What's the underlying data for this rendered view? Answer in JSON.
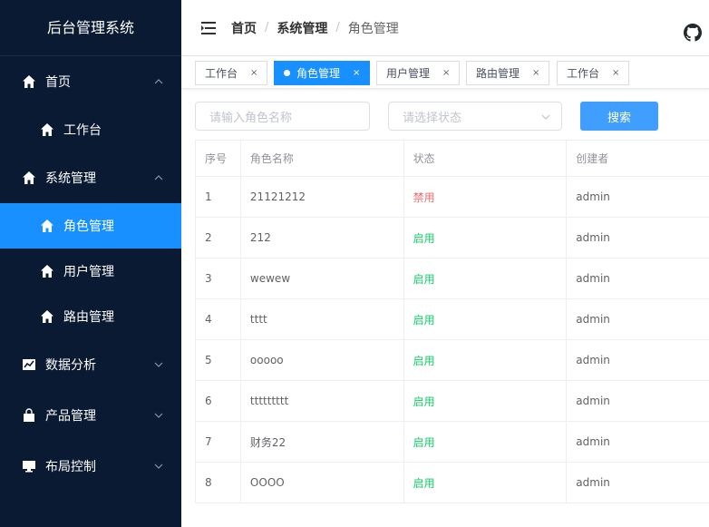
{
  "app_title": "后台管理系统",
  "sidebar": {
    "items": [
      {
        "label": "首页",
        "type": "group",
        "expanded": true,
        "icon": "home-icon"
      },
      {
        "label": "工作台",
        "type": "sub",
        "icon": "home-icon"
      },
      {
        "label": "系统管理",
        "type": "group",
        "expanded": true,
        "icon": "home-icon"
      },
      {
        "label": "角色管理",
        "type": "sub",
        "active": true,
        "icon": "home-icon"
      },
      {
        "label": "用户管理",
        "type": "sub",
        "icon": "home-icon"
      },
      {
        "label": "路由管理",
        "type": "sub",
        "icon": "home-icon"
      },
      {
        "label": "数据分析",
        "type": "group",
        "expanded": false,
        "icon": "chart-icon"
      },
      {
        "label": "产品管理",
        "type": "group",
        "expanded": false,
        "icon": "bag-icon"
      },
      {
        "label": "布局控制",
        "type": "group",
        "expanded": false,
        "icon": "monitor-icon"
      }
    ]
  },
  "breadcrumb": [
    "首页",
    "系统管理",
    "角色管理"
  ],
  "tags": [
    {
      "label": "工作台",
      "active": false
    },
    {
      "label": "角色管理",
      "active": true
    },
    {
      "label": "用户管理",
      "active": false
    },
    {
      "label": "路由管理",
      "active": false
    },
    {
      "label": "工作台",
      "active": false
    }
  ],
  "tag_close": "×",
  "filters": {
    "name_placeholder": "请输入角色名称",
    "status_placeholder": "请选择状态",
    "search_label": "搜索"
  },
  "table": {
    "headers": [
      "序号",
      "角色名称",
      "状态",
      "创建者"
    ],
    "rows": [
      [
        "1",
        "21121212",
        "禁用",
        "admin"
      ],
      [
        "2",
        "212",
        "启用",
        "admin"
      ],
      [
        "3",
        "wewew",
        "启用",
        "admin"
      ],
      [
        "4",
        "tttt",
        "启用",
        "admin"
      ],
      [
        "5",
        "ooooo",
        "启用",
        "admin"
      ],
      [
        "6",
        "ttttttttt",
        "启用",
        "admin"
      ],
      [
        "7",
        "财务22",
        "启用",
        "admin"
      ],
      [
        "8",
        "OOOO",
        "启用",
        "admin"
      ]
    ]
  },
  "colors": {
    "sidebar_bg": "#0b1a33",
    "active_blue": "#1890ff",
    "button_blue": "#409eff",
    "disabled_red": "#f56c6c",
    "enabled_green": "#13ce66"
  }
}
